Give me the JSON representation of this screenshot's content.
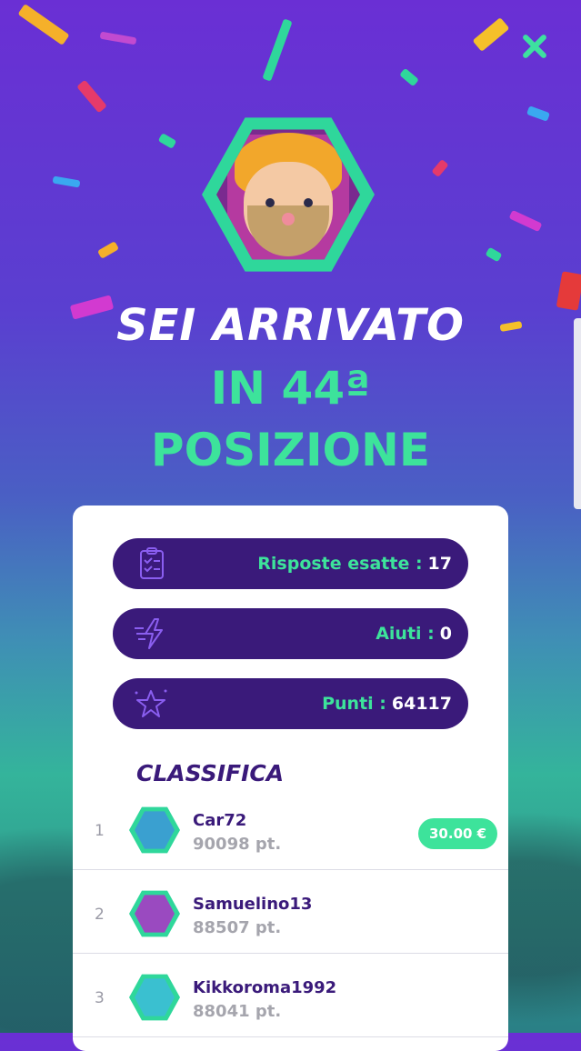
{
  "header": {
    "close_icon": "close-icon"
  },
  "result": {
    "line1": "SEI ARRIVATO",
    "line2": "IN 44ª",
    "line3": "POSIZIONE"
  },
  "stats": [
    {
      "icon": "checklist-icon",
      "label": "Risposte esatte :",
      "value": "17"
    },
    {
      "icon": "lightning-icon",
      "label": "Aiuti :",
      "value": "0"
    },
    {
      "icon": "star-icon",
      "label": "Punti :",
      "value": "64117"
    }
  ],
  "leaderboard": {
    "title": "CLASSIFICA",
    "rows": [
      {
        "rank": "1",
        "name": "Car72",
        "points": "90098 pt.",
        "prize": "30.00 €"
      },
      {
        "rank": "2",
        "name": "Samuelino13",
        "points": "88507 pt."
      },
      {
        "rank": "3",
        "name": "Kikkoroma1992",
        "points": "88041 pt."
      }
    ]
  },
  "colors": {
    "accent_green": "#3de39b",
    "dark_purple": "#3a1a7a",
    "bg_top": "#6a2fd4"
  }
}
